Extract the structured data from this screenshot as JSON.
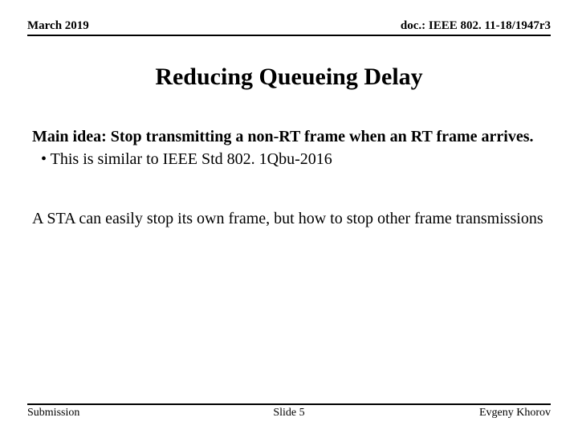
{
  "header": {
    "left": "March 2019",
    "right": "doc.: IEEE 802. 11-18/1947r3"
  },
  "title": "Reducing Queueing Delay",
  "content": {
    "main_idea": "Main idea: Stop transmitting a non-RT frame when an RT frame arrives.",
    "bullet1": "This is similar to IEEE Std 802. 1Qbu-2016",
    "para2": "A STA can easily stop its own frame, but how to stop other frame transmissions"
  },
  "footer": {
    "left": "Submission",
    "center": "Slide 5",
    "right": "Evgeny Khorov"
  }
}
